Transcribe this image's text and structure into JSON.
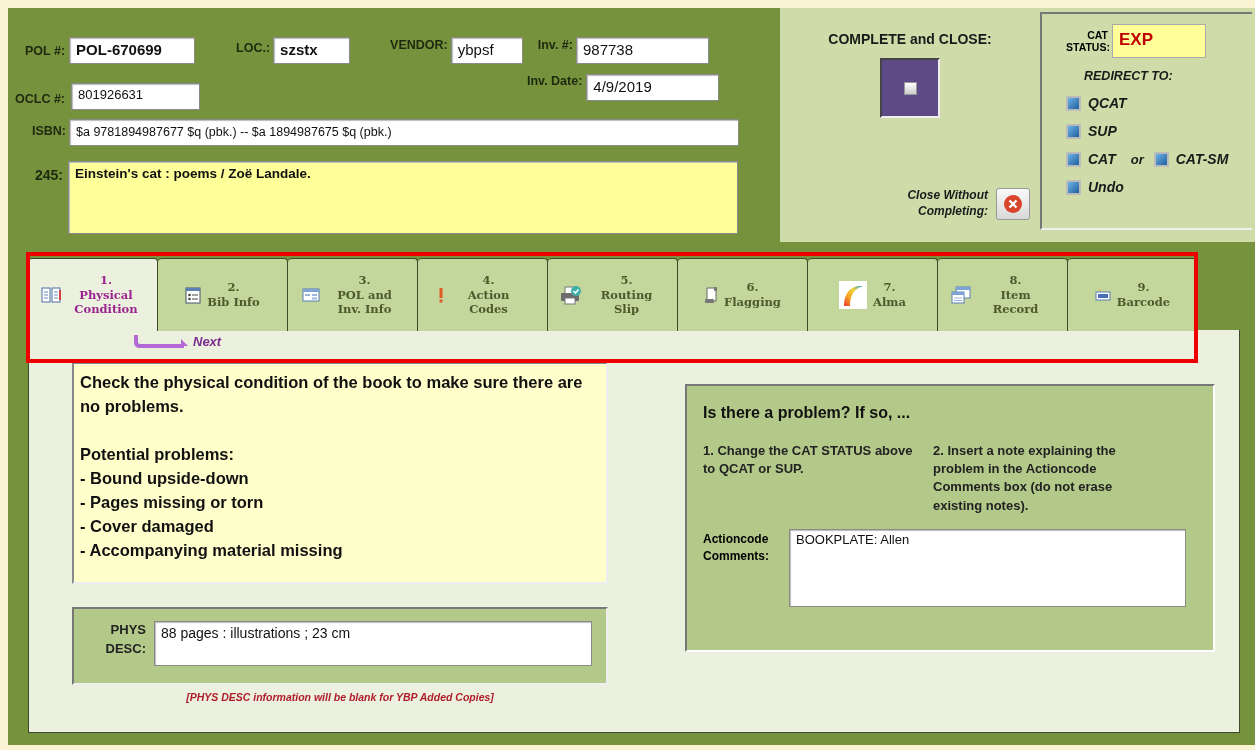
{
  "record": {
    "pol": {
      "label": "POL #:",
      "value": "POL-670699"
    },
    "loc": {
      "label": "LOC.:",
      "value": "szstx"
    },
    "vendor": {
      "label": "VENDOR:",
      "value": "ybpsf"
    },
    "inv_no": {
      "label": "Inv. #:",
      "value": "987738"
    },
    "oclc": {
      "label": "OCLC #:",
      "value": "801926631"
    },
    "inv_date": {
      "label": "Inv. Date:",
      "value": "4/9/2019"
    },
    "isbn": {
      "label": "ISBN:",
      "value": "$a 9781894987677 $q (pbk.) -- $a 1894987675 $q (pbk.)"
    },
    "title_245": {
      "label": "245:",
      "value": "Einstein's cat : poems / Zoë Landale."
    }
  },
  "complete": {
    "label": "COMPLETE and CLOSE:",
    "checked": false
  },
  "close_without": {
    "label": "Close Without Completing:"
  },
  "cat_status": {
    "label": "CAT STATUS:",
    "value": "EXP"
  },
  "redirect": {
    "heading": "REDIRECT TO:",
    "rows": [
      {
        "items": [
          "QCAT"
        ]
      },
      {
        "items": [
          "SUP"
        ]
      },
      {
        "items": [
          "CAT",
          "CAT-SM"
        ],
        "joiner": "or"
      },
      {
        "items": [
          "Undo"
        ]
      }
    ]
  },
  "tabs": [
    {
      "number": "1.",
      "label": "Physical Condition",
      "selected": true
    },
    {
      "number": "2.",
      "label": "Bib Info",
      "selected": false
    },
    {
      "number": "3.",
      "label": "POL and Inv. Info",
      "selected": false
    },
    {
      "number": "4.",
      "label": "Action Codes",
      "selected": false
    },
    {
      "number": "5.",
      "label": "Routing Slip",
      "selected": false
    },
    {
      "number": "6.",
      "label": "Flagging",
      "selected": false
    },
    {
      "number": "7.",
      "label": "Alma",
      "selected": false
    },
    {
      "number": "8.",
      "label": "Item Record",
      "selected": false
    },
    {
      "number": "9.",
      "label": "Barcode",
      "selected": false
    }
  ],
  "next": {
    "label": "Next"
  },
  "instructions": {
    "intro": "Check the physical condition of the book to make sure there are no problems.",
    "heading": "Potential problems:",
    "items": [
      "- Bound upside-down",
      "- Pages missing or torn",
      "- Cover damaged",
      "- Accompanying material missing"
    ]
  },
  "phys_desc": {
    "label": "PHYS DESC:",
    "value": "88 pages : illustrations ; 23 cm",
    "note": "[PHYS DESC information will be blank for YBP Added Copies]"
  },
  "problem": {
    "heading": "Is there a problem?  If so, ...",
    "steps": [
      "1. Change the CAT STATUS above to QCAT or SUP.",
      "2. Insert a note explaining the problem in the Actioncode Comments box (do not erase existing notes)."
    ],
    "comments_label": "Actioncode Comments:",
    "comments_value": "BOOKPLATE: Allen"
  }
}
